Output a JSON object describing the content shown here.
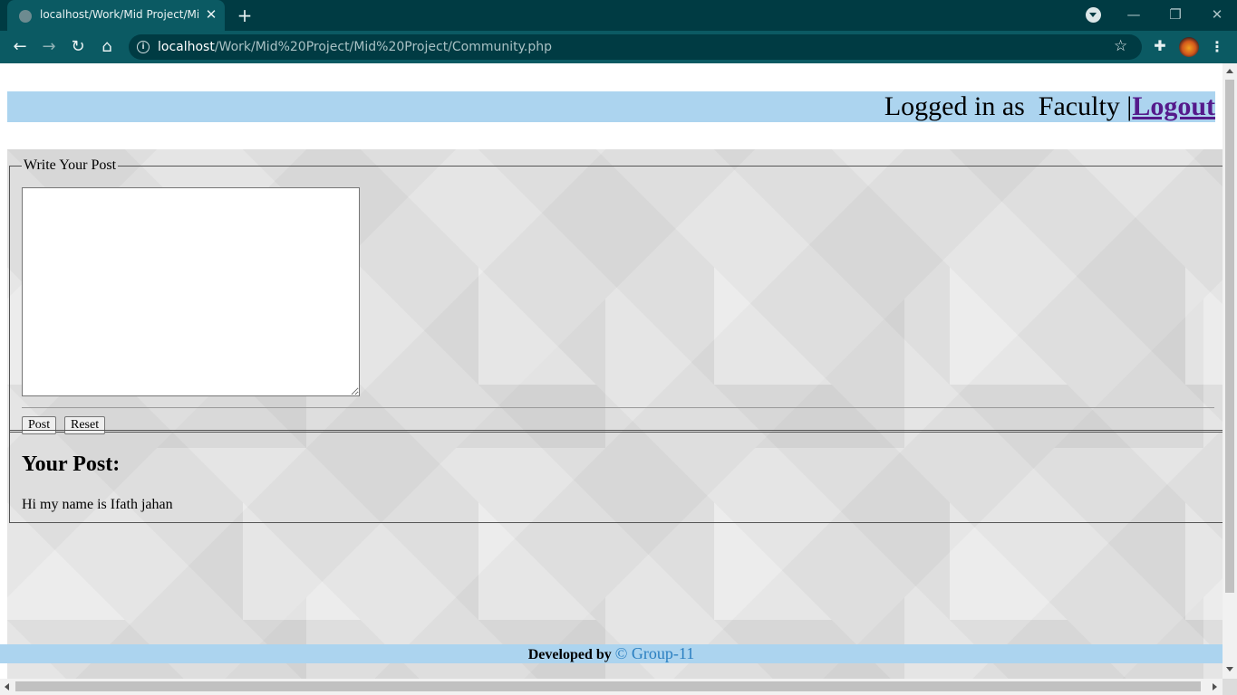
{
  "browser": {
    "tab_title": "localhost/Work/Mid Project/Mid",
    "close_tab_glyph": "✕",
    "new_tab_glyph": "+",
    "url_host": "localhost",
    "url_path": "/Work/Mid%20Project/Mid%20Project/Community.php",
    "back_glyph": "←",
    "forward_glyph": "→",
    "reload_glyph": "↻",
    "home_glyph": "⌂",
    "info_glyph": "i",
    "star_glyph": "☆",
    "extensions_glyph": "✚",
    "menu_glyph": "⋮",
    "minimize_glyph": "—",
    "restore_glyph": "❐",
    "close_glyph": "✕",
    "icons": [
      "back-arrow-icon",
      "forward-arrow-icon",
      "reload-icon",
      "home-icon",
      "info-icon",
      "star-icon",
      "puzzle-icon",
      "avatar",
      "kebab-menu-icon"
    ]
  },
  "header": {
    "logged_in_prefix": "Logged in as  Faculty |",
    "logout_label": "Logout"
  },
  "post_form": {
    "legend": "Write Your Post",
    "textarea_value": "",
    "post_button": "Post",
    "reset_button": "Reset"
  },
  "posts": {
    "heading": "Your Post:",
    "items": [
      "Hi my name is Ifath jahan"
    ]
  },
  "footer": {
    "developed_by": "Developed by",
    "group": "© Group-11"
  },
  "colors": {
    "header_bar": "#acd4ef",
    "footer_bar": "#acd4ef",
    "logout_link": "#551a8b",
    "group_link": "#2a7fc1",
    "browser_dark": "#003b43",
    "browser_toolbar": "#0b5a63"
  }
}
